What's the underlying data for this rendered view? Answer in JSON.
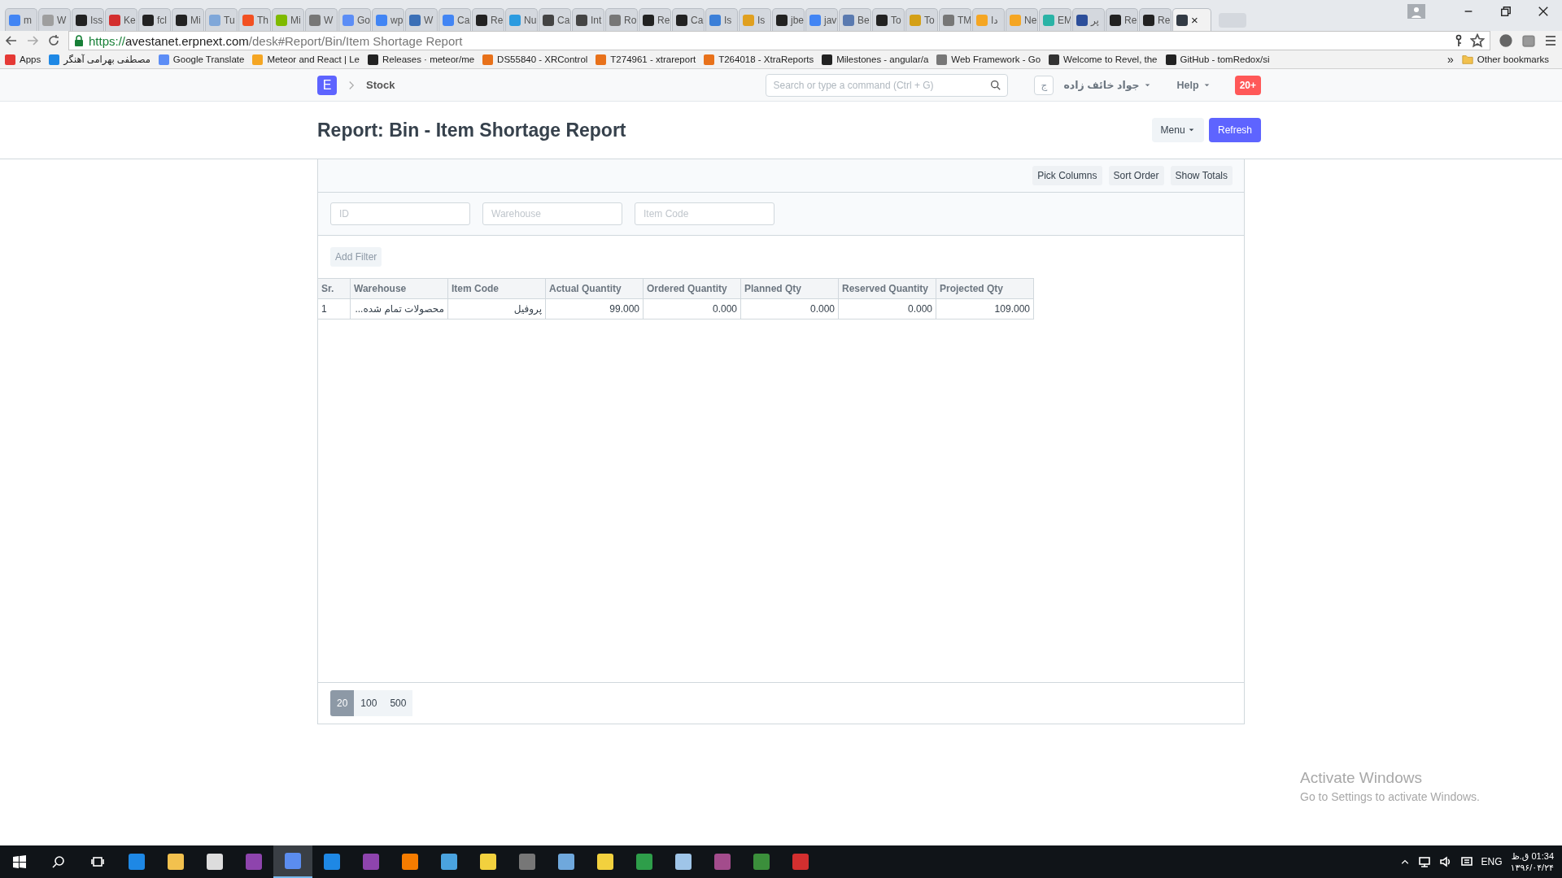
{
  "browser": {
    "tabs": [
      {
        "label": "m",
        "color": "#4285f4",
        "selected": false
      },
      {
        "label": "W",
        "color": "#9e9e9e",
        "selected": false
      },
      {
        "label": "Iss",
        "color": "#222222",
        "selected": false
      },
      {
        "label": "Ke",
        "color": "#d32f2f",
        "selected": false
      },
      {
        "label": "fcl",
        "color": "#222222",
        "selected": false
      },
      {
        "label": "Mi",
        "color": "#222222",
        "selected": false
      },
      {
        "label": "Tu",
        "color": "#7fa7d9",
        "selected": false
      },
      {
        "label": "Th",
        "color": "#f25022",
        "selected": false
      },
      {
        "label": "Mi",
        "color": "#7fba00",
        "selected": false
      },
      {
        "label": "W",
        "color": "#777777",
        "selected": false
      },
      {
        "label": "Go",
        "color": "#5c8df6",
        "selected": false
      },
      {
        "label": "wp",
        "color": "#4285f4",
        "selected": false
      },
      {
        "label": "W",
        "color": "#3b6fb6",
        "selected": false
      },
      {
        "label": "Ca",
        "color": "#4285f4",
        "selected": false
      },
      {
        "label": "Re",
        "color": "#222222",
        "selected": false
      },
      {
        "label": "Nu",
        "color": "#2b9be0",
        "selected": false
      },
      {
        "label": "Ca",
        "color": "#444444",
        "selected": false
      },
      {
        "label": "Int",
        "color": "#444444",
        "selected": false
      },
      {
        "label": "Ro",
        "color": "#777777",
        "selected": false
      },
      {
        "label": "Re",
        "color": "#222222",
        "selected": false
      },
      {
        "label": "Ca",
        "color": "#222222",
        "selected": false
      },
      {
        "label": "Is",
        "color": "#3b7fd8",
        "selected": false
      },
      {
        "label": "Is",
        "color": "#e0a020",
        "selected": false
      },
      {
        "label": "jbe",
        "color": "#222222",
        "selected": false
      },
      {
        "label": "jav",
        "color": "#4285f4",
        "selected": false
      },
      {
        "label": "Be",
        "color": "#5a7ab0",
        "selected": false
      },
      {
        "label": "To",
        "color": "#222222",
        "selected": false
      },
      {
        "label": "To",
        "color": "#d4a017",
        "selected": false
      },
      {
        "label": "TM",
        "color": "#777777",
        "selected": false
      },
      {
        "label": "دا",
        "color": "#f5a623",
        "selected": false
      },
      {
        "label": "Ne",
        "color": "#f5a623",
        "selected": false
      },
      {
        "label": "EM",
        "color": "#2ab3a6",
        "selected": false
      },
      {
        "label": "پر",
        "color": "#2c4e9a",
        "selected": false
      },
      {
        "label": "Re",
        "color": "#222222",
        "selected": false
      },
      {
        "label": "Re",
        "color": "#222222",
        "selected": false
      },
      {
        "label": "×",
        "color": "#333b44",
        "selected": true
      }
    ],
    "address": {
      "scheme": "https://",
      "host": "avestanet.erpnext.com",
      "path": "/desk#Report/Bin/Item Shortage Report"
    },
    "bookmarks": [
      {
        "label": "Apps",
        "color": "#e53935"
      },
      {
        "label": "مصطفی بهرامی آهنگر",
        "color": "#1e88e5"
      },
      {
        "label": "Google Translate",
        "color": "#5c8df6"
      },
      {
        "label": "Meteor and React | Le",
        "color": "#f5a623"
      },
      {
        "label": "Releases · meteor/me",
        "color": "#222222"
      },
      {
        "label": "DS55840 - XRControl",
        "color": "#e8711a"
      },
      {
        "label": "T274961 - xtrareport",
        "color": "#e8711a"
      },
      {
        "label": "T264018 - XtraReports",
        "color": "#e8711a"
      },
      {
        "label": "Milestones - angular/a",
        "color": "#222222"
      },
      {
        "label": "Web Framework - Go",
        "color": "#777777"
      },
      {
        "label": "Welcome to Revel, the",
        "color": "#333333"
      },
      {
        "label": "GitHub - tomRedox/si",
        "color": "#222222"
      }
    ],
    "more": "»",
    "other_bookmarks": "Other bookmarks"
  },
  "navbar": {
    "logo": "E",
    "breadcrumb": "Stock",
    "search": {
      "placeholder": "Search or type a command (Ctrl + G)"
    },
    "avatar": "ج",
    "user": "جواد خائف زاده",
    "help": "Help",
    "notifications": "20+"
  },
  "page": {
    "title": "Report: Bin - Item Shortage Report",
    "menu": "Menu",
    "refresh": "Refresh"
  },
  "toolbar": [
    "Pick Columns",
    "Sort Order",
    "Show Totals"
  ],
  "filters": [
    {
      "placeholder": "ID"
    },
    {
      "placeholder": "Warehouse"
    },
    {
      "placeholder": "Item Code"
    }
  ],
  "add_filter": "Add Filter",
  "table": {
    "columns": [
      "Sr.",
      "Warehouse",
      "Item Code",
      "Actual Quantity",
      "Ordered Quantity",
      "Planned Qty",
      "Reserved Quantity",
      "Projected Qty"
    ],
    "rows": [
      [
        "1",
        "محصولات تمام شده...",
        "پروفیل",
        "99.000",
        "0.000",
        "0.000",
        "0.000",
        "109.000"
      ]
    ]
  },
  "page_sizes": [
    {
      "label": "20",
      "selected": true
    },
    {
      "label": "100",
      "selected": false
    },
    {
      "label": "500",
      "selected": false
    }
  ],
  "activation": {
    "title": "Activate Windows",
    "text": "Go to Settings to activate Windows."
  },
  "taskbar": {
    "apps": [
      {
        "color": "#1e88e5",
        "selected": false
      },
      {
        "color": "#f2c14e",
        "selected": false
      },
      {
        "color": "#dddddd",
        "selected": false
      },
      {
        "color": "#8e44ad",
        "selected": false
      },
      {
        "color": "#5b8def",
        "selected": true
      },
      {
        "color": "#1e88e5",
        "selected": false
      },
      {
        "color": "#8e44ad",
        "selected": false
      },
      {
        "color": "#f57c00",
        "selected": false
      },
      {
        "color": "#4aa3df",
        "selected": false
      },
      {
        "color": "#f2d13e",
        "selected": false
      },
      {
        "color": "#777777",
        "selected": false
      },
      {
        "color": "#6fa8dc",
        "selected": false
      },
      {
        "color": "#f2d13e",
        "selected": false
      },
      {
        "color": "#2e9e4a",
        "selected": false
      },
      {
        "color": "#9fc5e8",
        "selected": false
      },
      {
        "color": "#a34c8c",
        "selected": false
      },
      {
        "color": "#3b8f3b",
        "selected": false
      },
      {
        "color": "#d32f2f",
        "selected": false
      }
    ],
    "language": "ENG",
    "time": "01:34 ق.ظ",
    "date": "۱۳۹۶/۰۴/۲۴"
  }
}
